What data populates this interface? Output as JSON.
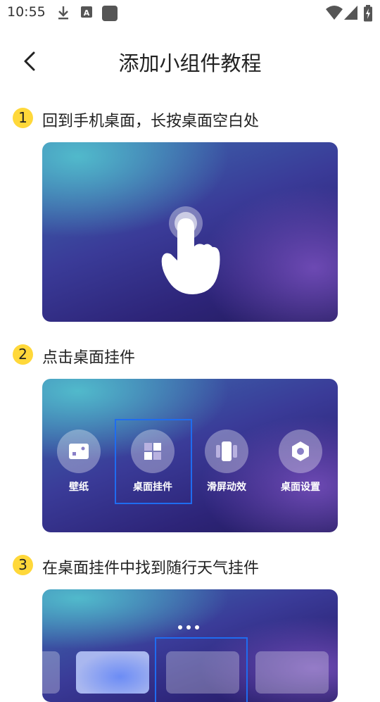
{
  "status_bar": {
    "time": "10:55",
    "icons": [
      "download-icon",
      "font-a-icon",
      "square-app-icon",
      "wifi-icon",
      "signal-icon",
      "battery-charging-icon"
    ]
  },
  "header": {
    "title": "添加小组件教程",
    "back_icon": "chevron-left-icon"
  },
  "steps": [
    {
      "number": "1",
      "text": "回到手机桌面，长按桌面空白处"
    },
    {
      "number": "2",
      "text": "点击桌面挂件"
    },
    {
      "number": "3",
      "text": "在桌面挂件中找到随行天气挂件"
    }
  ],
  "step2_options": [
    {
      "label": "壁纸",
      "icon": "wallpaper-icon"
    },
    {
      "label": "桌面挂件",
      "icon": "widget-icon"
    },
    {
      "label": "滑屏动效",
      "icon": "slide-effect-icon"
    },
    {
      "label": "桌面设置",
      "icon": "hexagon-settings-icon"
    }
  ],
  "colors": {
    "badge": "#ffd83a",
    "highlight": "#1f6cf0",
    "title_text": "#222222"
  }
}
